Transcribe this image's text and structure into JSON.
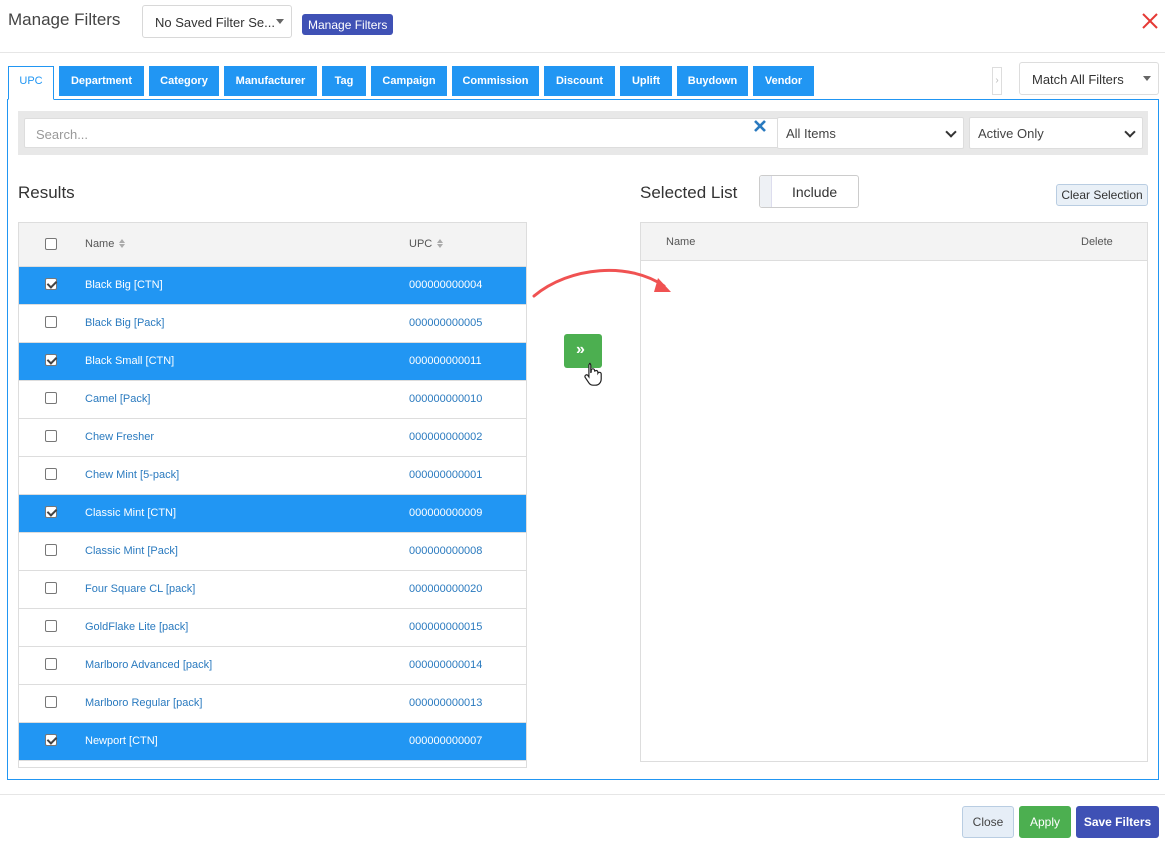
{
  "header": {
    "title": "Manage Filters",
    "saved_filter": "No Saved Filter Se...",
    "manage_button": "Manage Filters"
  },
  "tabs": [
    {
      "label": "UPC",
      "active": true
    },
    {
      "label": "Department"
    },
    {
      "label": "Category"
    },
    {
      "label": "Manufacturer"
    },
    {
      "label": "Tag"
    },
    {
      "label": "Campaign"
    },
    {
      "label": "Commission"
    },
    {
      "label": "Discount"
    },
    {
      "label": "Uplift"
    },
    {
      "label": "Buydown"
    },
    {
      "label": "Vendor"
    }
  ],
  "match_select": "Match All Filters",
  "search": {
    "placeholder": "Search...",
    "items_filter": "All Items",
    "status_filter": "Active Only"
  },
  "results": {
    "title": "Results",
    "columns": {
      "name": "Name",
      "upc": "UPC"
    },
    "rows": [
      {
        "name": "Black Big [CTN]",
        "upc": "000000000004",
        "selected": true
      },
      {
        "name": "Black Big [Pack]",
        "upc": "000000000005",
        "selected": false
      },
      {
        "name": "Black Small [CTN]",
        "upc": "000000000011",
        "selected": true
      },
      {
        "name": "Camel [Pack]",
        "upc": "000000000010",
        "selected": false
      },
      {
        "name": "Chew Fresher",
        "upc": "000000000002",
        "selected": false
      },
      {
        "name": "Chew Mint [5-pack]",
        "upc": "000000000001",
        "selected": false
      },
      {
        "name": "Classic Mint [CTN]",
        "upc": "000000000009",
        "selected": true
      },
      {
        "name": "Classic Mint [Pack]",
        "upc": "000000000008",
        "selected": false
      },
      {
        "name": "Four Square CL [pack]",
        "upc": "000000000020",
        "selected": false
      },
      {
        "name": "GoldFlake Lite [pack]",
        "upc": "000000000015",
        "selected": false
      },
      {
        "name": "Marlboro Advanced [pack]",
        "upc": "000000000014",
        "selected": false
      },
      {
        "name": "Marlboro Regular [pack]",
        "upc": "000000000013",
        "selected": false
      },
      {
        "name": "Newport [CTN]",
        "upc": "000000000007",
        "selected": true
      }
    ]
  },
  "selected_list": {
    "title": "Selected List",
    "include_label": "Include",
    "clear_label": "Clear Selection",
    "columns": {
      "name": "Name",
      "delete": "Delete"
    }
  },
  "footer": {
    "close": "Close",
    "apply": "Apply",
    "save": "Save Filters"
  },
  "colors": {
    "primary_blue": "#2196f3",
    "indigo": "#3f51b5",
    "green": "#4caf50",
    "close_red": "#e53935",
    "annotation_arrow": "#f05252"
  }
}
